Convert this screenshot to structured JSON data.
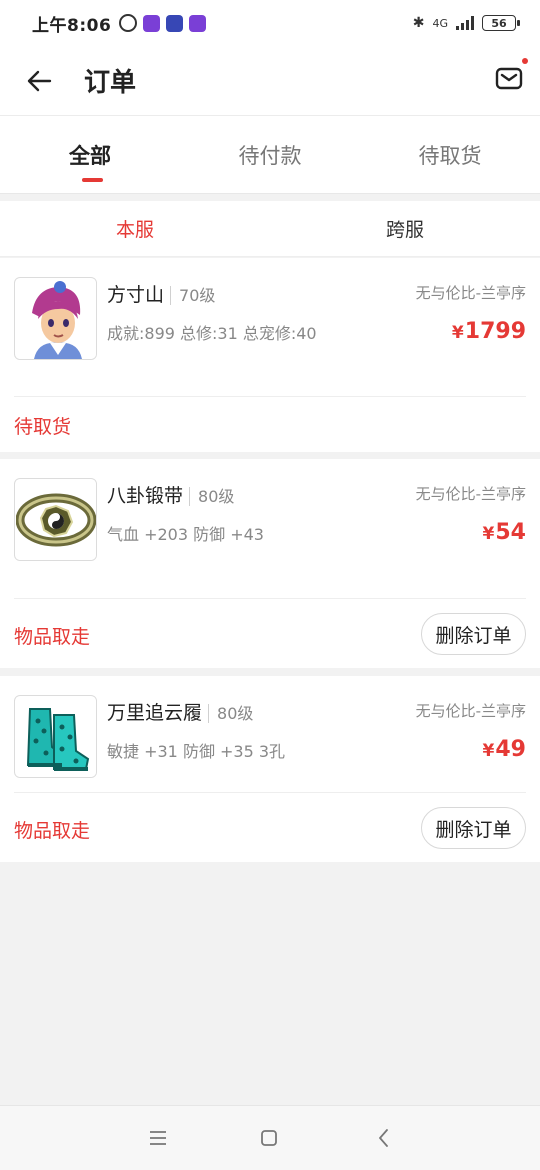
{
  "status_bar": {
    "time": "上午8:06",
    "network": "4G",
    "battery": "56"
  },
  "header": {
    "title": "订单"
  },
  "tabs": [
    {
      "label": "全部",
      "active": true
    },
    {
      "label": "待付款",
      "active": false
    },
    {
      "label": "待取货",
      "active": false
    }
  ],
  "subtabs": [
    {
      "label": "本服",
      "active": true
    },
    {
      "label": "跨服",
      "active": false
    }
  ],
  "orders": [
    {
      "name": "方寸山",
      "level": "70级",
      "server": "无与伦比-兰亭序",
      "attrs": "成就:899  总修:31  总宠修:40",
      "currency": "¥",
      "price": "1799",
      "status": "待取货",
      "action": ""
    },
    {
      "name": "八卦锻带",
      "level": "80级",
      "server": "无与伦比-兰亭序",
      "attrs": "气血 +203 防御 +43",
      "currency": "¥",
      "price": "54",
      "status": "物品取走",
      "action": "删除订单"
    },
    {
      "name": "万里追云履",
      "level": "80级",
      "server": "无与伦比-兰亭序",
      "attrs": "敏捷 +31 防御 +35  3孔",
      "currency": "¥",
      "price": "49",
      "status": "物品取走",
      "action": "删除订单"
    }
  ],
  "colors": {
    "accent": "#e53935",
    "background": "#f2f2f2"
  },
  "icons": {
    "back": "arrow-left-icon",
    "mail": "mail-icon",
    "nav_menu": "menu-icon",
    "nav_home": "home-icon",
    "nav_back": "chevron-left-icon"
  }
}
